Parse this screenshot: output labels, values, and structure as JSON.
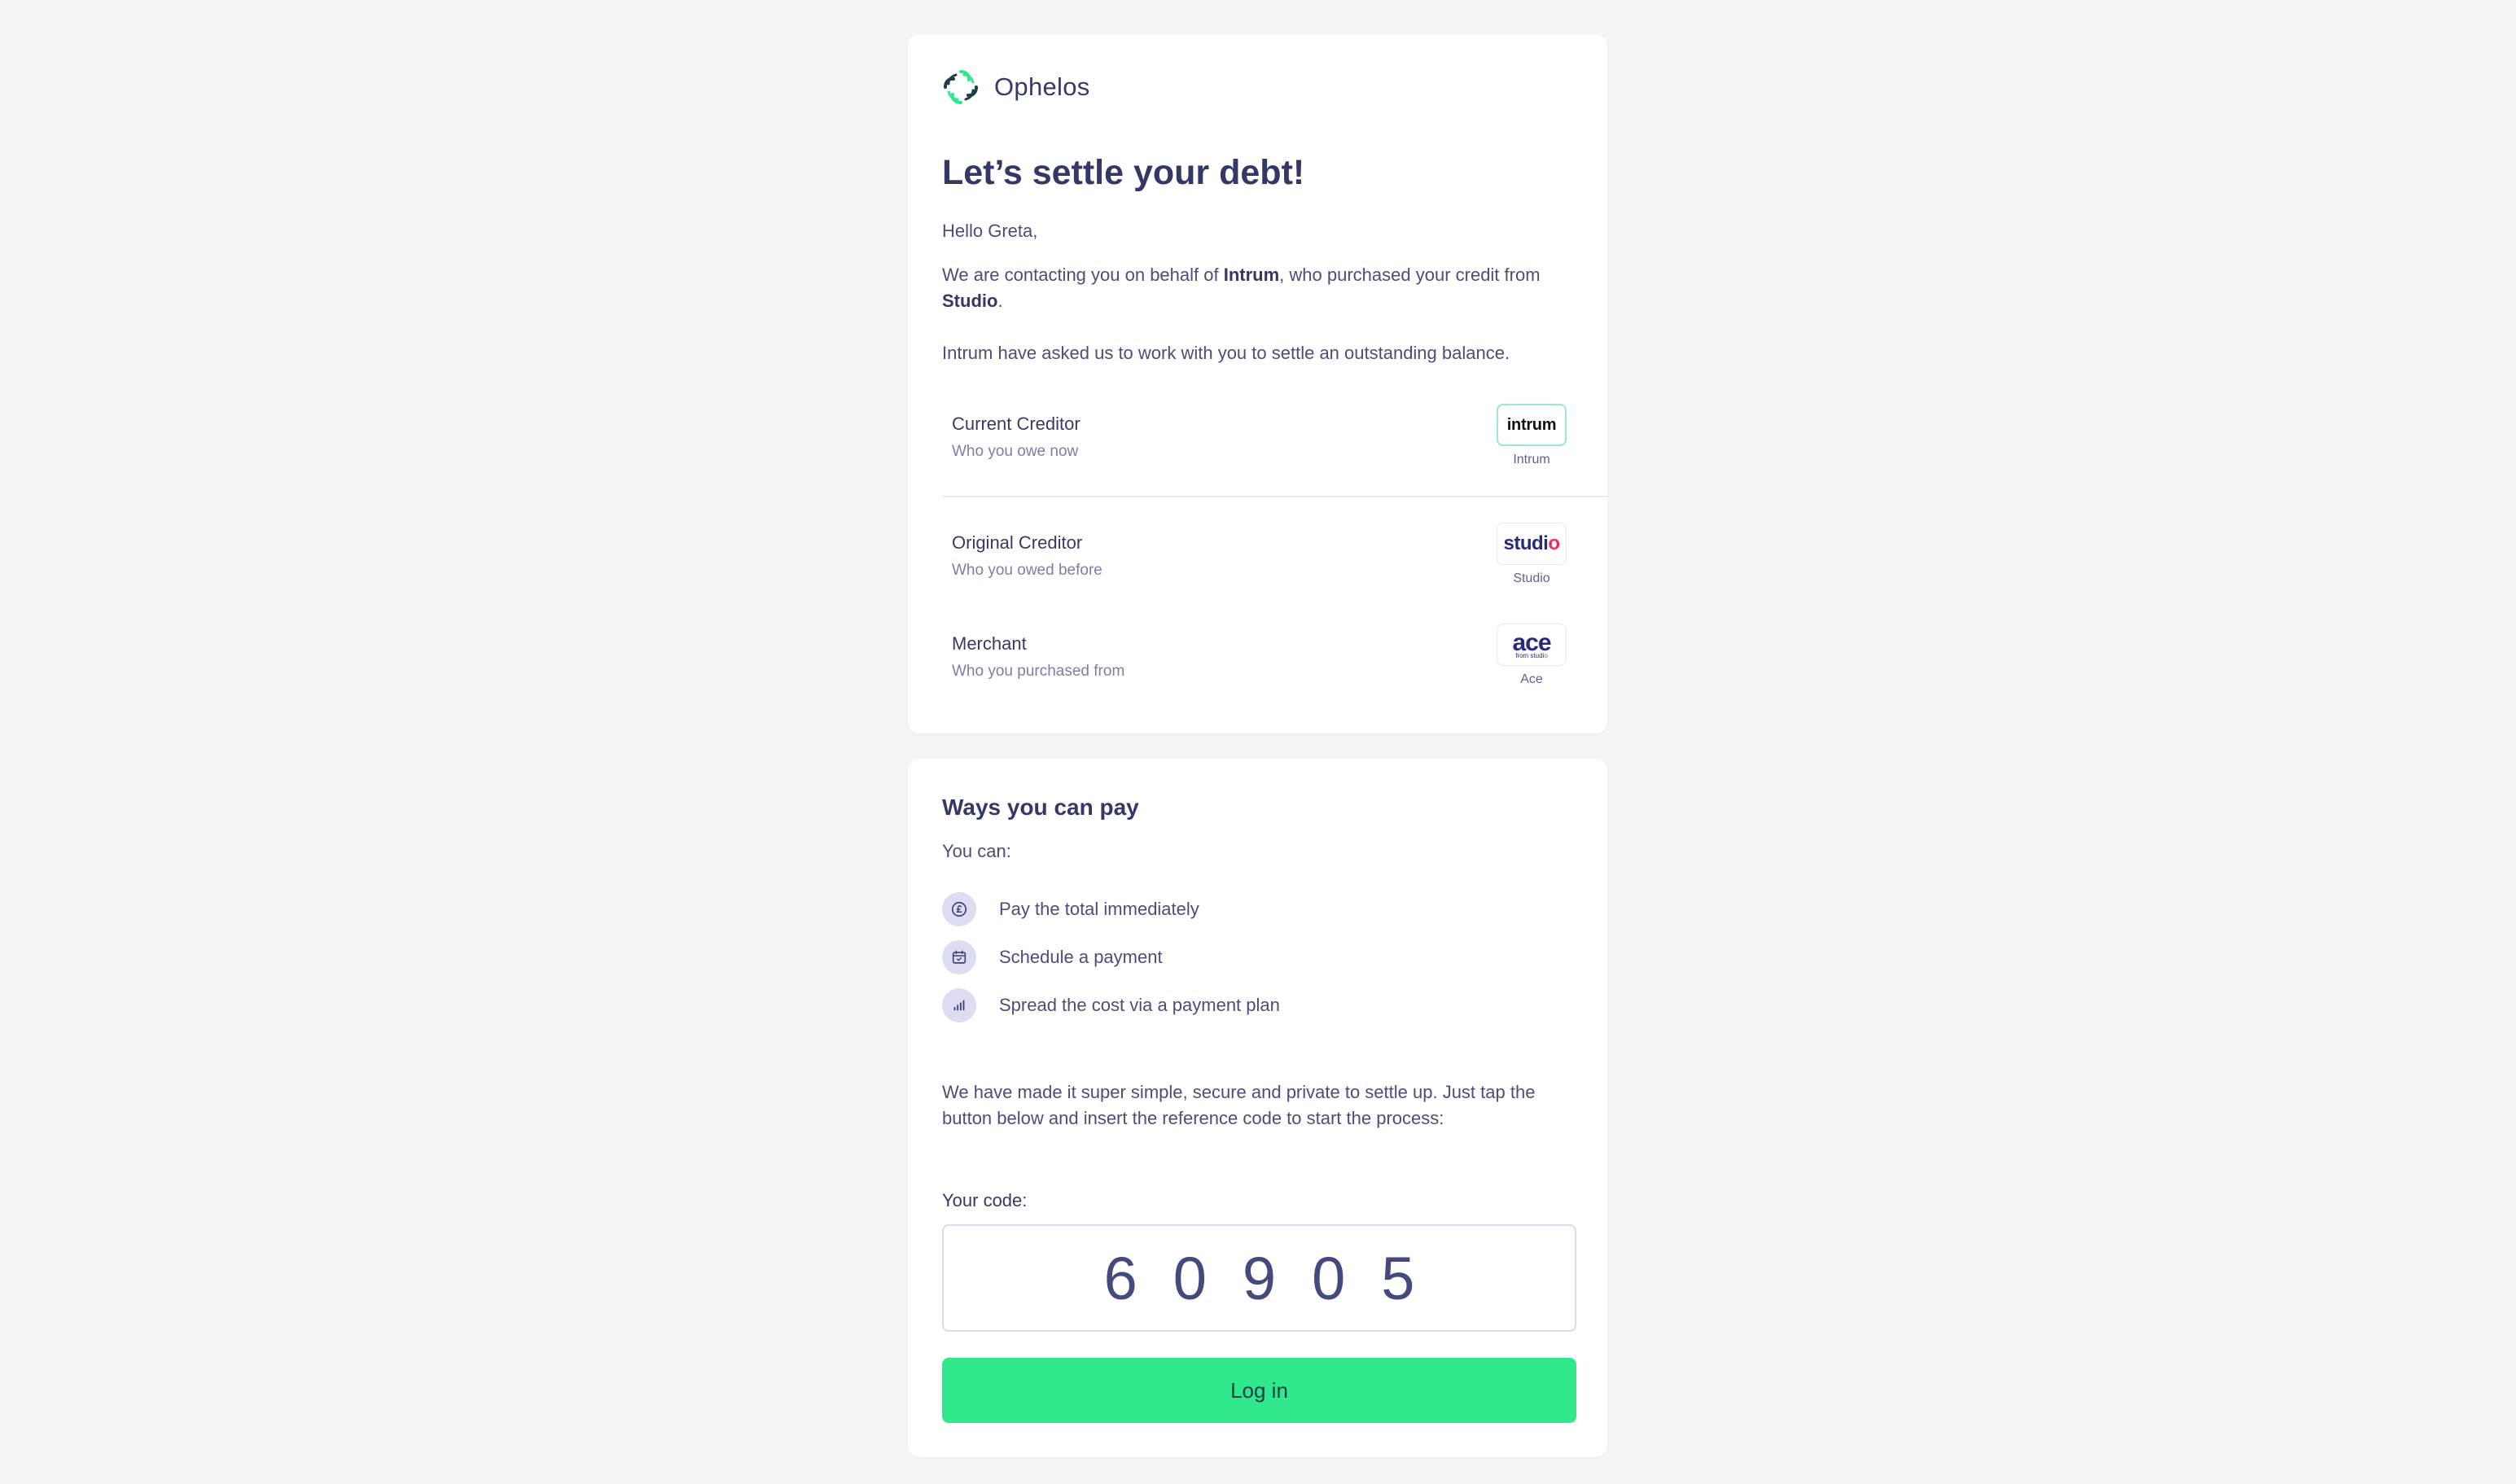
{
  "brand": {
    "name": "Ophelos",
    "colors": {
      "primary": "#363a66",
      "accent": "#2fe88b",
      "logo_dark": "#1f3d45",
      "logo_green": "#2fe88b"
    }
  },
  "intro": {
    "title": "Let’s settle your debt!",
    "greeting": "Hello Greta,",
    "contact_pre": "We are contacting you on behalf of ",
    "current_creditor_bold": "Intrum",
    "contact_mid": ", who purchased your credit from ",
    "original_creditor_bold": "Studio",
    "contact_post": ".",
    "request": "Intrum have asked us to work with you to settle an outstanding balance."
  },
  "parties": [
    {
      "title": "Current Creditor",
      "subtitle": "Who you owe now",
      "logo_text": "intrum",
      "caption": "Intrum"
    },
    {
      "title": "Original Creditor",
      "subtitle": "Who you owed before",
      "logo_text": "studio",
      "caption": "Studio"
    },
    {
      "title": "Merchant",
      "subtitle": "Who you purchased from",
      "logo_text": "ace",
      "logo_subtext": "from studio",
      "caption": "Ace"
    }
  ],
  "payment": {
    "title": "Ways you can pay",
    "intro": "You can:",
    "options": [
      {
        "label": "Pay the total immediately",
        "icon": "pound-coin-icon"
      },
      {
        "label": "Schedule a payment",
        "icon": "calendar-icon"
      },
      {
        "label": "Spread the cost via a payment plan",
        "icon": "bar-chart-icon"
      }
    ],
    "instructions": "We have made it super simple, secure and private to settle up. Just tap the button below and insert the reference code to start the process:",
    "code_label": "Your code:",
    "code": "60905",
    "login_label": "Log in"
  }
}
